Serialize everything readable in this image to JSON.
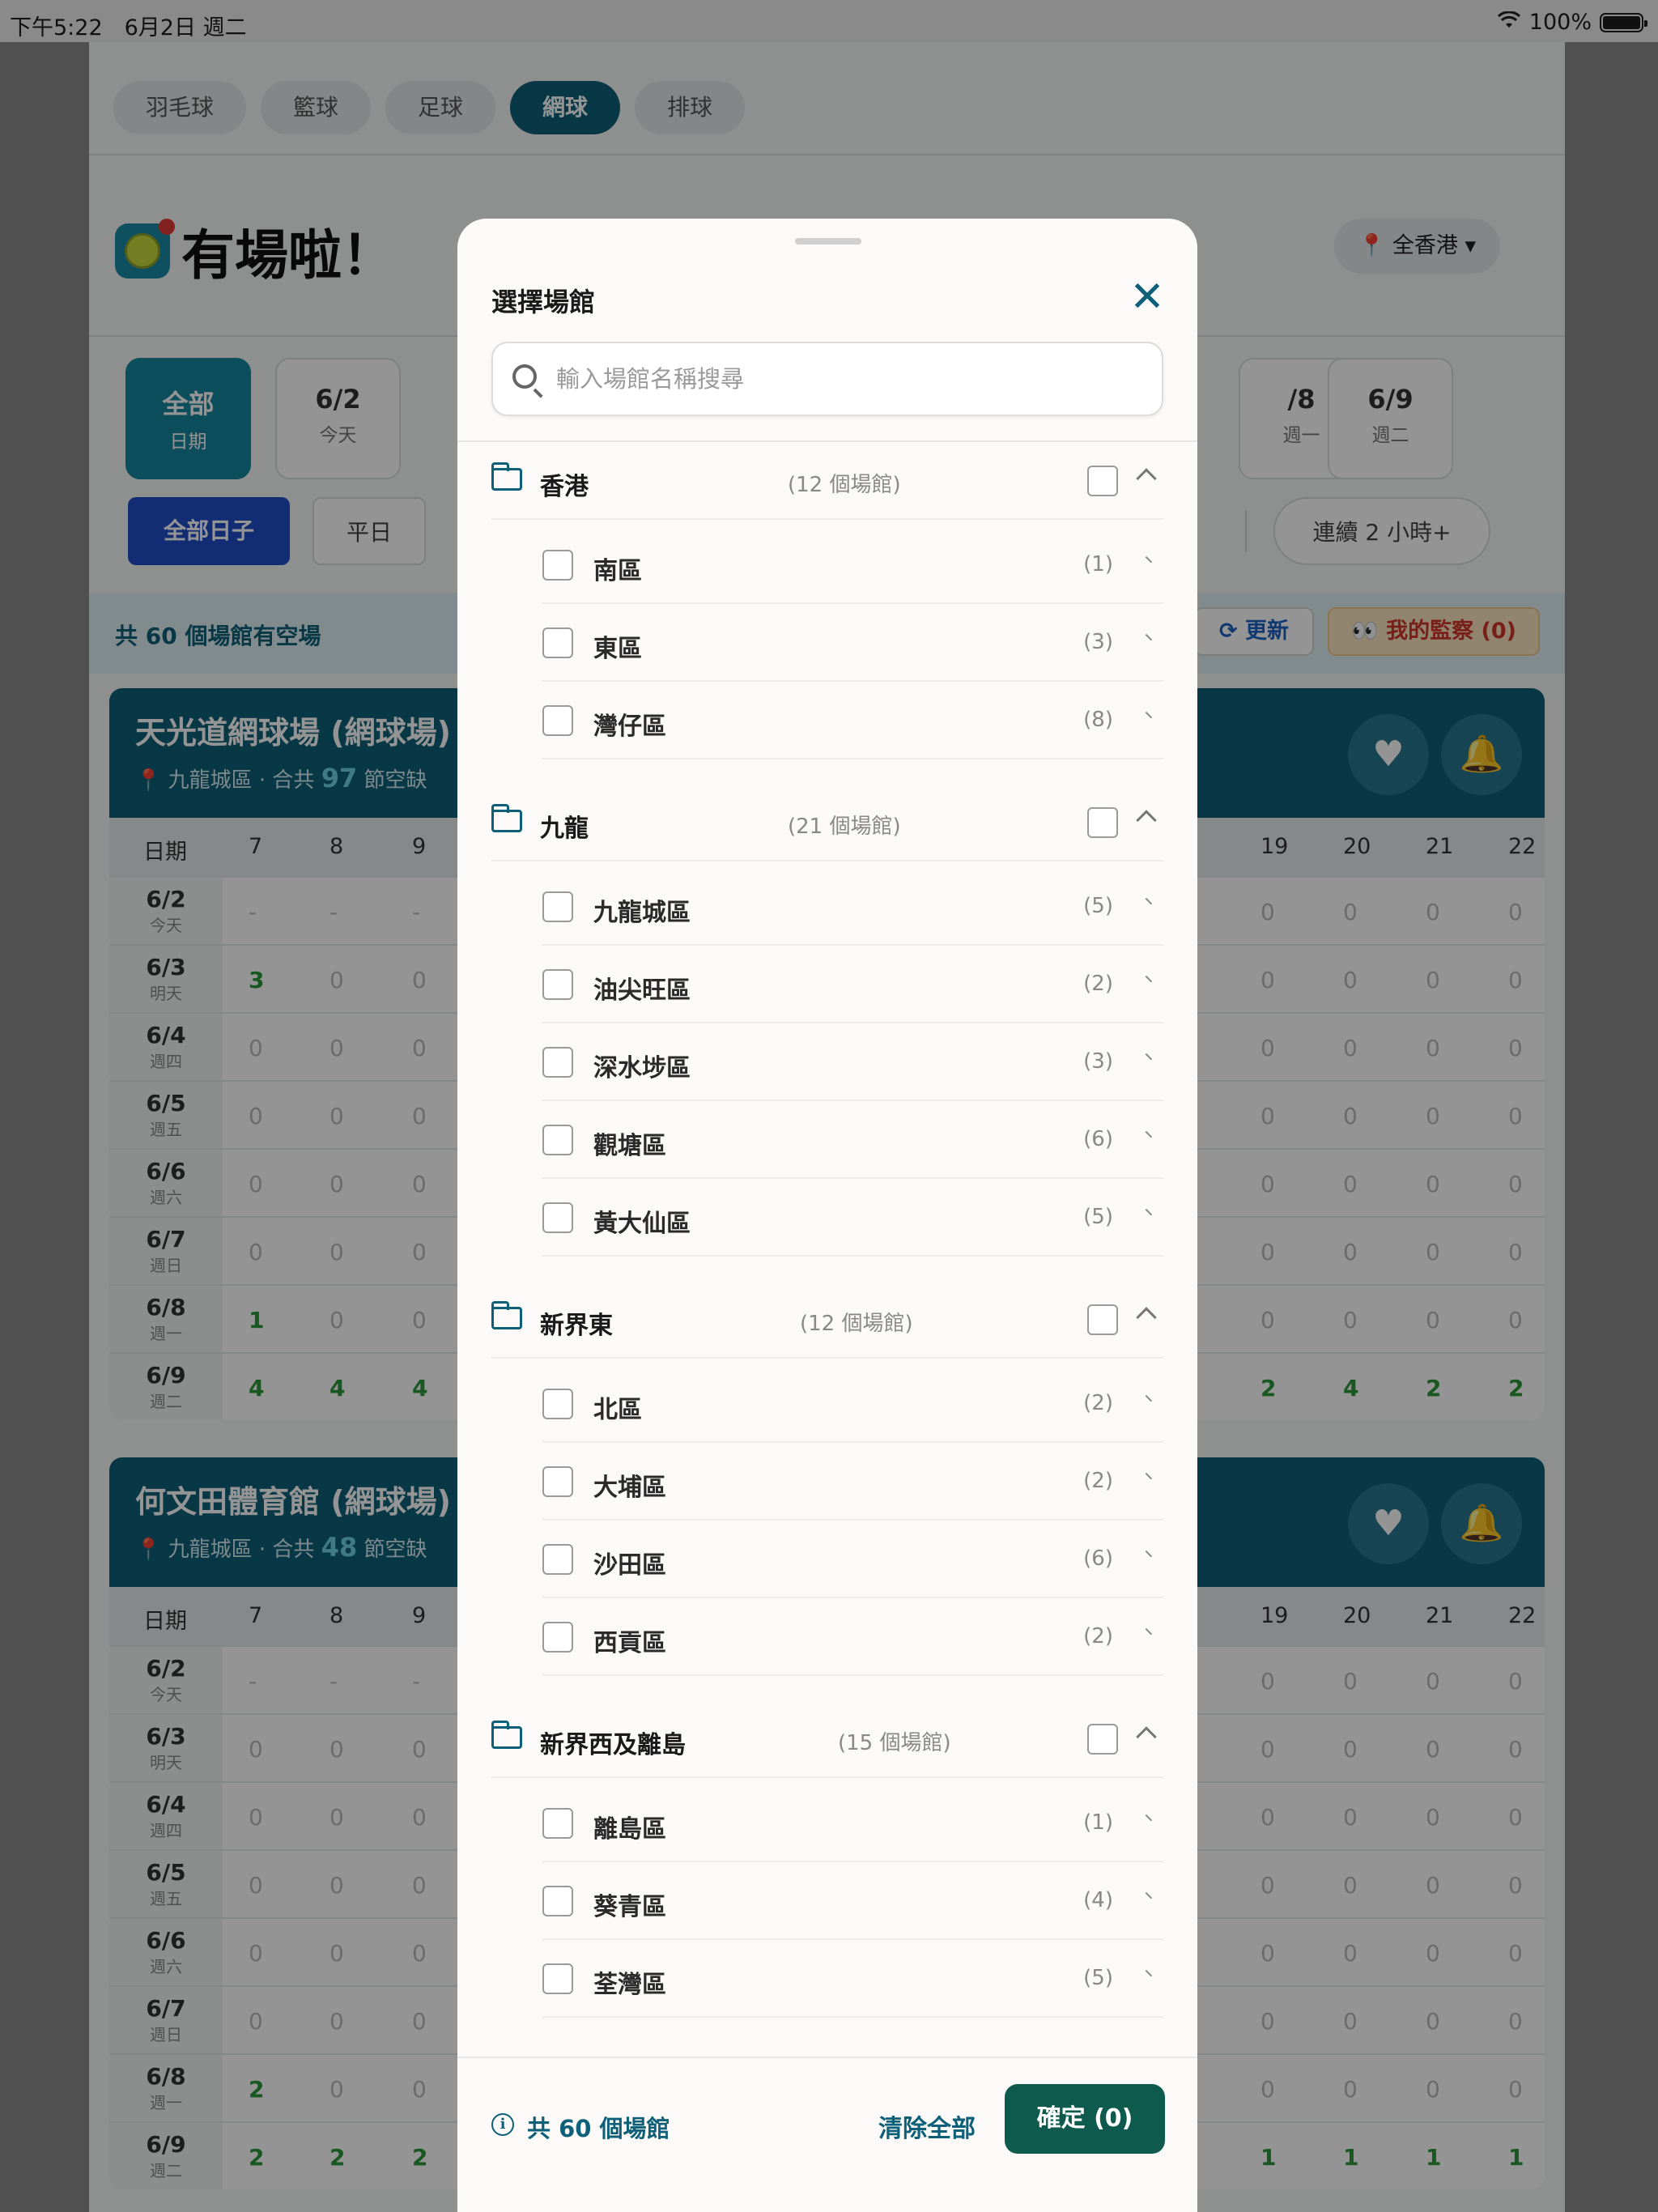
{
  "status": {
    "time": "下午5:22　6月2日 週二",
    "battery": "100%"
  },
  "app": {
    "sport_tabs": [
      "羽毛球",
      "籃球",
      "足球",
      "網球",
      "排球"
    ],
    "title": "有場啦！",
    "region": "全香港",
    "dates": [
      {
        "d": "全部",
        "w": "日期"
      },
      {
        "d": "6/2",
        "w": "今天"
      },
      {
        "d": "/8",
        "w": "週一"
      },
      {
        "d": "6/9",
        "w": "週二"
      }
    ],
    "filters": {
      "all": "全部日子",
      "weekday": "平日",
      "continuous": "連續 2 小時+"
    },
    "summary": "共 60 個場館有空場",
    "refresh": "更新",
    "watch": "我的監察 (0)",
    "venues": [
      {
        "name": "天光道網球場 (網球場)",
        "meta_pre": "九龍城區 · 合共 ",
        "meta_num": "97",
        "meta_post": " 節空缺",
        "hours_left": [
          "7",
          "8",
          "9"
        ],
        "hours_right": [
          "19",
          "20",
          "21",
          "22"
        ],
        "rows": [
          {
            "d": "6/2",
            "w": "今天",
            "left": [
              "-",
              "-",
              "-"
            ],
            "right": [
              "0",
              "0",
              "0",
              "0"
            ]
          },
          {
            "d": "6/3",
            "w": "明天",
            "left": [
              "3",
              "0",
              "0"
            ],
            "right": [
              "0",
              "0",
              "0",
              "0"
            ]
          },
          {
            "d": "6/4",
            "w": "週四",
            "left": [
              "0",
              "0",
              "0"
            ],
            "right": [
              "0",
              "0",
              "0",
              "0"
            ]
          },
          {
            "d": "6/5",
            "w": "週五",
            "left": [
              "0",
              "0",
              "0"
            ],
            "right": [
              "0",
              "0",
              "0",
              "0"
            ]
          },
          {
            "d": "6/6",
            "w": "週六",
            "left": [
              "0",
              "0",
              "0"
            ],
            "right": [
              "0",
              "0",
              "0",
              "0"
            ]
          },
          {
            "d": "6/7",
            "w": "週日",
            "left": [
              "0",
              "0",
              "0"
            ],
            "right": [
              "0",
              "0",
              "0",
              "0"
            ]
          },
          {
            "d": "6/8",
            "w": "週一",
            "left": [
              "1",
              "0",
              "0"
            ],
            "right": [
              "0",
              "0",
              "0",
              "0"
            ]
          },
          {
            "d": "6/9",
            "w": "週二",
            "left": [
              "4",
              "4",
              "4"
            ],
            "right": [
              "2",
              "4",
              "2",
              "2"
            ]
          }
        ]
      },
      {
        "name": "何文田體育館 (網球場)",
        "meta_pre": "九龍城區 · 合共 ",
        "meta_num": "48",
        "meta_post": " 節空缺",
        "hours_left": [
          "7",
          "8",
          "9"
        ],
        "hours_right": [
          "19",
          "20",
          "21",
          "22"
        ],
        "rows": [
          {
            "d": "6/2",
            "w": "今天",
            "left": [
              "-",
              "-",
              "-"
            ],
            "right": [
              "0",
              "0",
              "0",
              "0"
            ]
          },
          {
            "d": "6/3",
            "w": "明天",
            "left": [
              "0",
              "0",
              "0"
            ],
            "right": [
              "0",
              "0",
              "0",
              "0"
            ]
          },
          {
            "d": "6/4",
            "w": "週四",
            "left": [
              "0",
              "0",
              "0"
            ],
            "right": [
              "0",
              "0",
              "0",
              "0"
            ]
          },
          {
            "d": "6/5",
            "w": "週五",
            "left": [
              "0",
              "0",
              "0"
            ],
            "right": [
              "0",
              "0",
              "0",
              "0"
            ]
          },
          {
            "d": "6/6",
            "w": "週六",
            "left": [
              "0",
              "0",
              "0"
            ],
            "right": [
              "0",
              "0",
              "0",
              "0"
            ]
          },
          {
            "d": "6/7",
            "w": "週日",
            "left": [
              "0",
              "0",
              "0"
            ],
            "right": [
              "0",
              "0",
              "0",
              "0"
            ]
          },
          {
            "d": "6/8",
            "w": "週一",
            "left": [
              "2",
              "0",
              "0"
            ],
            "right": [
              "0",
              "0",
              "0",
              "0"
            ]
          },
          {
            "d": "6/9",
            "w": "週二",
            "left": [
              "2",
              "2",
              "2"
            ],
            "right": [
              "1",
              "1",
              "1",
              "1"
            ]
          }
        ]
      }
    ],
    "date_col_label": "日期"
  },
  "modal": {
    "title": "選擇場館",
    "search_placeholder": "輸入場館名稱搜尋",
    "search_value": "",
    "groups": [
      {
        "name": "香港",
        "count": "(12 個場館)",
        "items": [
          {
            "name": "南區",
            "count": "(1)"
          },
          {
            "name": "東區",
            "count": "(3)"
          },
          {
            "name": "灣仔區",
            "count": "(8)"
          }
        ]
      },
      {
        "name": "九龍",
        "count": "(21 個場館)",
        "items": [
          {
            "name": "九龍城區",
            "count": "(5)"
          },
          {
            "name": "油尖旺區",
            "count": "(2)"
          },
          {
            "name": "深水埗區",
            "count": "(3)"
          },
          {
            "name": "觀塘區",
            "count": "(6)"
          },
          {
            "name": "黃大仙區",
            "count": "(5)"
          }
        ]
      },
      {
        "name": "新界東",
        "count": "(12 個場館)",
        "items": [
          {
            "name": "北區",
            "count": "(2)"
          },
          {
            "name": "大埔區",
            "count": "(2)"
          },
          {
            "name": "沙田區",
            "count": "(6)"
          },
          {
            "name": "西貢區",
            "count": "(2)"
          }
        ]
      },
      {
        "name": "新界西及離島",
        "count": "(15 個場館)",
        "items": [
          {
            "name": "離島區",
            "count": "(1)"
          },
          {
            "name": "葵青區",
            "count": "(4)"
          },
          {
            "name": "荃灣區",
            "count": "(5)"
          }
        ]
      }
    ],
    "footer": {
      "total": "共 60 個場館",
      "clear": "清除全部",
      "confirm": "確定 (0)"
    }
  },
  "colors": {
    "accent": "#0e5f78",
    "confirm": "#0e5a4d",
    "available": "#2b9a3a"
  }
}
